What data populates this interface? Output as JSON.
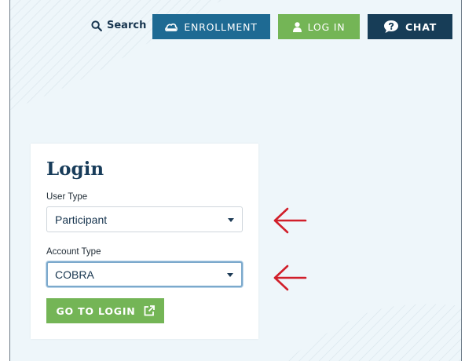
{
  "header": {
    "search_label": "Search",
    "enrollment_label": "ENROLLMENT",
    "login_label": "LOG IN",
    "chat_label": "CHAT"
  },
  "login_card": {
    "title": "Login",
    "user_type": {
      "label": "User Type",
      "value": "Participant"
    },
    "account_type": {
      "label": "Account Type",
      "value": "COBRA"
    },
    "go_button_label": "GO TO LOGIN"
  },
  "colors": {
    "background": "#eef6fa",
    "navy": "#17354f",
    "enrollment_blue": "#1e6a93",
    "green": "#74b556",
    "chat_dark": "#173d57",
    "annotation_red": "#d11f2a"
  },
  "icons": {
    "search": "search-icon",
    "enrollment": "cloud-icon",
    "login": "user-icon",
    "chat": "chat-question-icon",
    "go_to_login": "external-link-icon",
    "annotation": "arrow-left-icon"
  }
}
